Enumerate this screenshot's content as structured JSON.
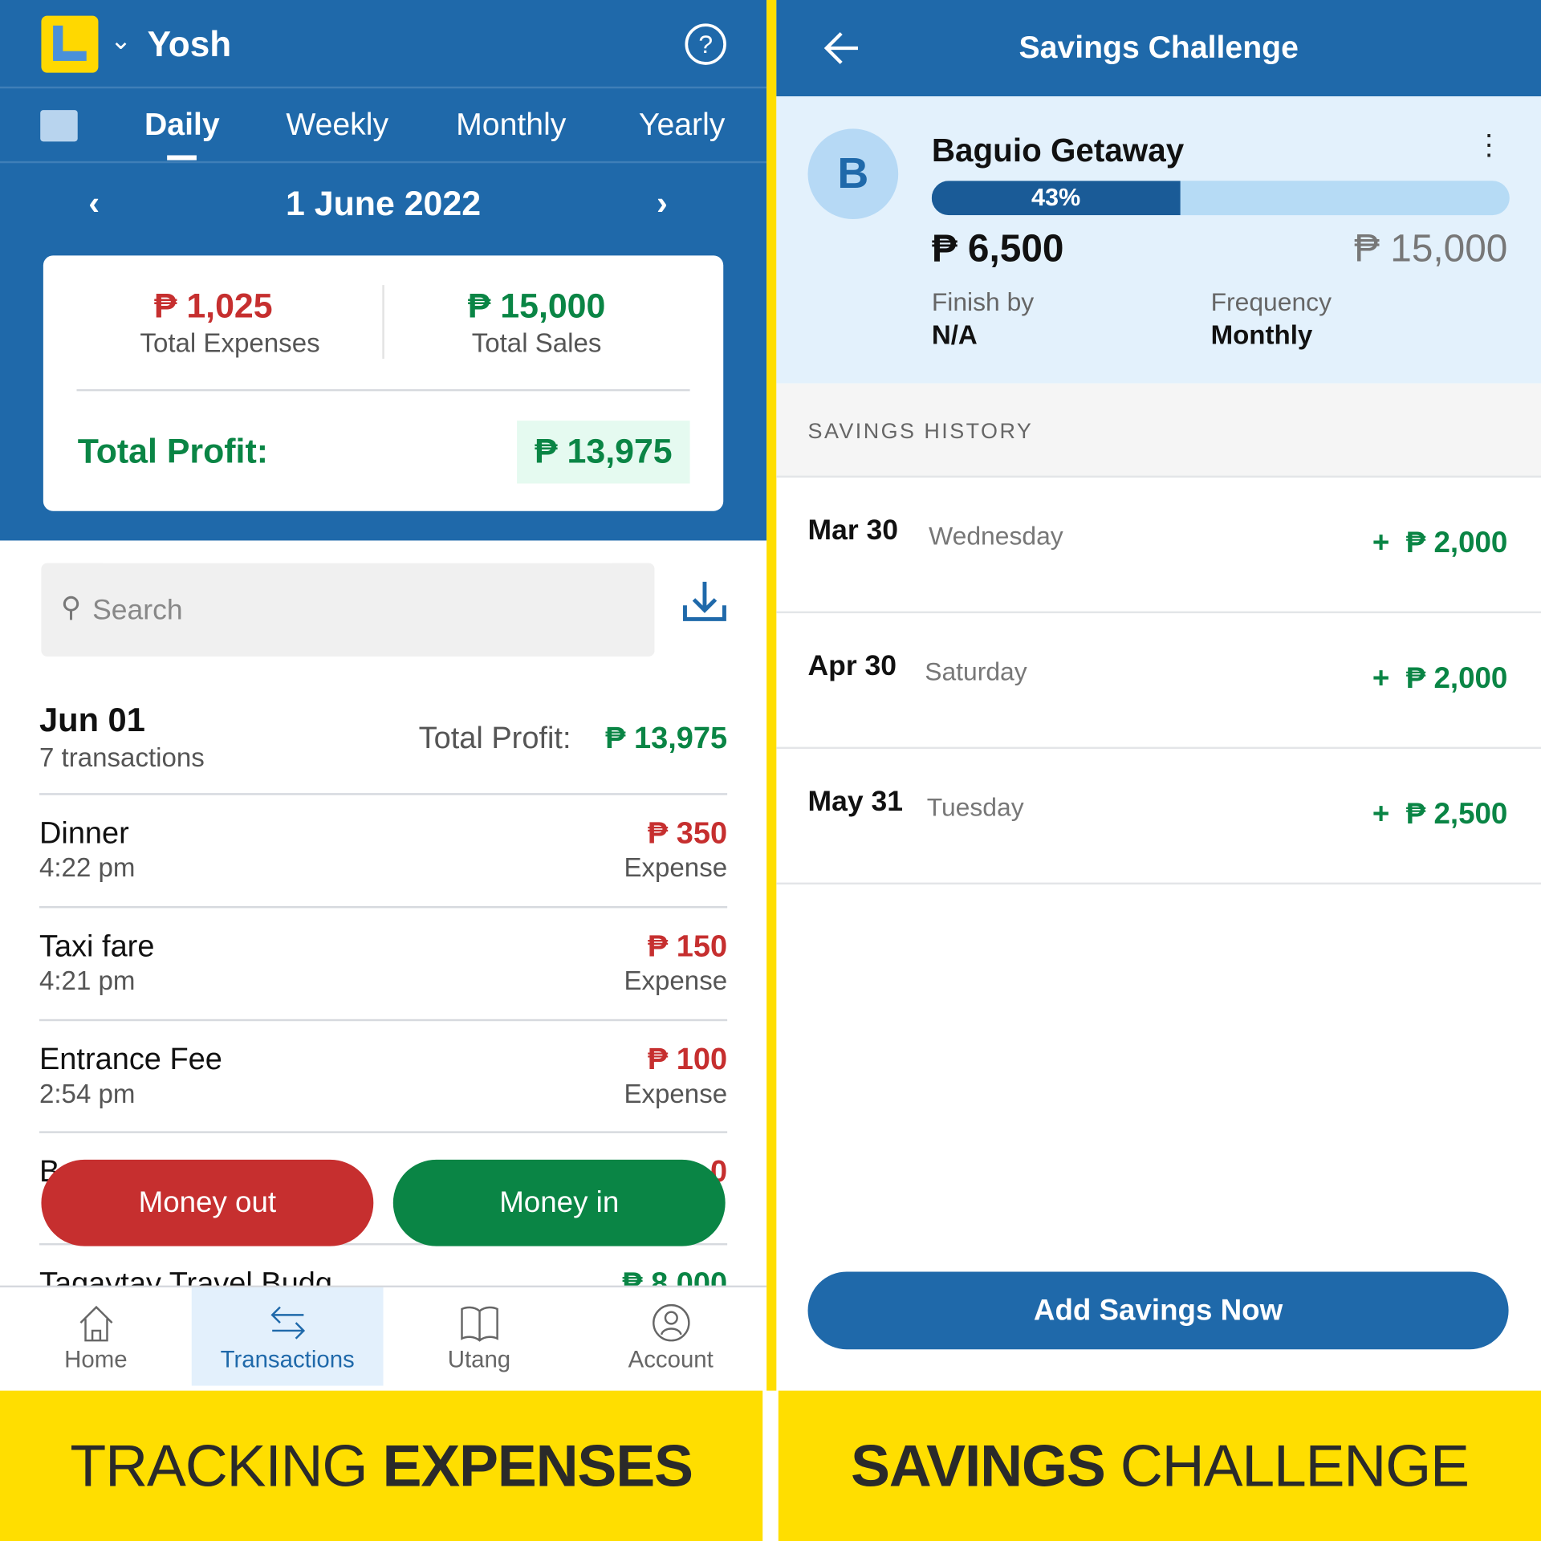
{
  "left": {
    "header": {
      "account_name": "Yosh"
    },
    "tabs": [
      {
        "label": "Daily",
        "active": true
      },
      {
        "label": "Weekly"
      },
      {
        "label": "Monthly"
      },
      {
        "label": "Yearly"
      }
    ],
    "date": "1 June 2022",
    "summary": {
      "expenses": "₱ 1,025",
      "expenses_label": "Total Expenses",
      "sales": "₱ 15,000",
      "sales_label": "Total Sales",
      "profit_label": "Total Profit:",
      "profit": "₱ 13,975"
    },
    "search": {
      "placeholder": "Search"
    },
    "day": {
      "date": "Jun 01",
      "count": "7 transactions",
      "profit_label": "Total Profit:",
      "profit": "₱ 13,975"
    },
    "transactions": [
      {
        "name": "Dinner",
        "time": "4:22 pm",
        "amount": "₱ 350",
        "type": "Expense"
      },
      {
        "name": "Taxi fare",
        "time": "4:21 pm",
        "amount": "₱ 150",
        "type": "Expense"
      },
      {
        "name": "Entrance Fee",
        "time": "2:54 pm",
        "amount": "₱ 100",
        "type": "Expense"
      },
      {
        "name": "B",
        "time": "",
        "amount": "0",
        "type": ""
      },
      {
        "name": "Tagaytay Travel Budg",
        "time": "",
        "amount": "₱ 8,000",
        "type": ""
      }
    ],
    "buttons": {
      "money_out": "Money out",
      "money_in": "Money in"
    },
    "nav": [
      {
        "label": "Home",
        "icon": "home-icon"
      },
      {
        "label": "Transactions",
        "icon": "transfer-icon",
        "active": true
      },
      {
        "label": "Utang",
        "icon": "book-icon"
      },
      {
        "label": "Account",
        "icon": "user-circle-icon"
      }
    ],
    "banner": {
      "light": "TRACKING ",
      "bold": "EXPENSES"
    }
  },
  "right": {
    "header": {
      "title": "Savings Challenge"
    },
    "goal": {
      "avatar": "B",
      "name": "Baguio Getaway",
      "progress_percent": 43,
      "progress_label": "43%",
      "saved": "₱ 6,500",
      "target": "₱ 15,000",
      "finish_label": "Finish by",
      "finish_value": "N/A",
      "frequency_label": "Frequency",
      "frequency_value": "Monthly"
    },
    "history_title": "SAVINGS HISTORY",
    "history": [
      {
        "date": "Mar 30",
        "weekday": "Wednesday",
        "amount": "+  ₱ 2,000"
      },
      {
        "date": "Apr 30",
        "weekday": "Saturday",
        "amount": "+  ₱ 2,000"
      },
      {
        "date": "May 31",
        "weekday": "Tuesday",
        "amount": "+  ₱ 2,500"
      }
    ],
    "add_button": "Add Savings Now",
    "banner": {
      "bold": "SAVINGS ",
      "light": "CHALLENGE"
    }
  },
  "colors": {
    "primary": "#1f69aa",
    "accent_yellow": "#ffde00",
    "expense": "#c62f2f",
    "income": "#0a8545"
  }
}
